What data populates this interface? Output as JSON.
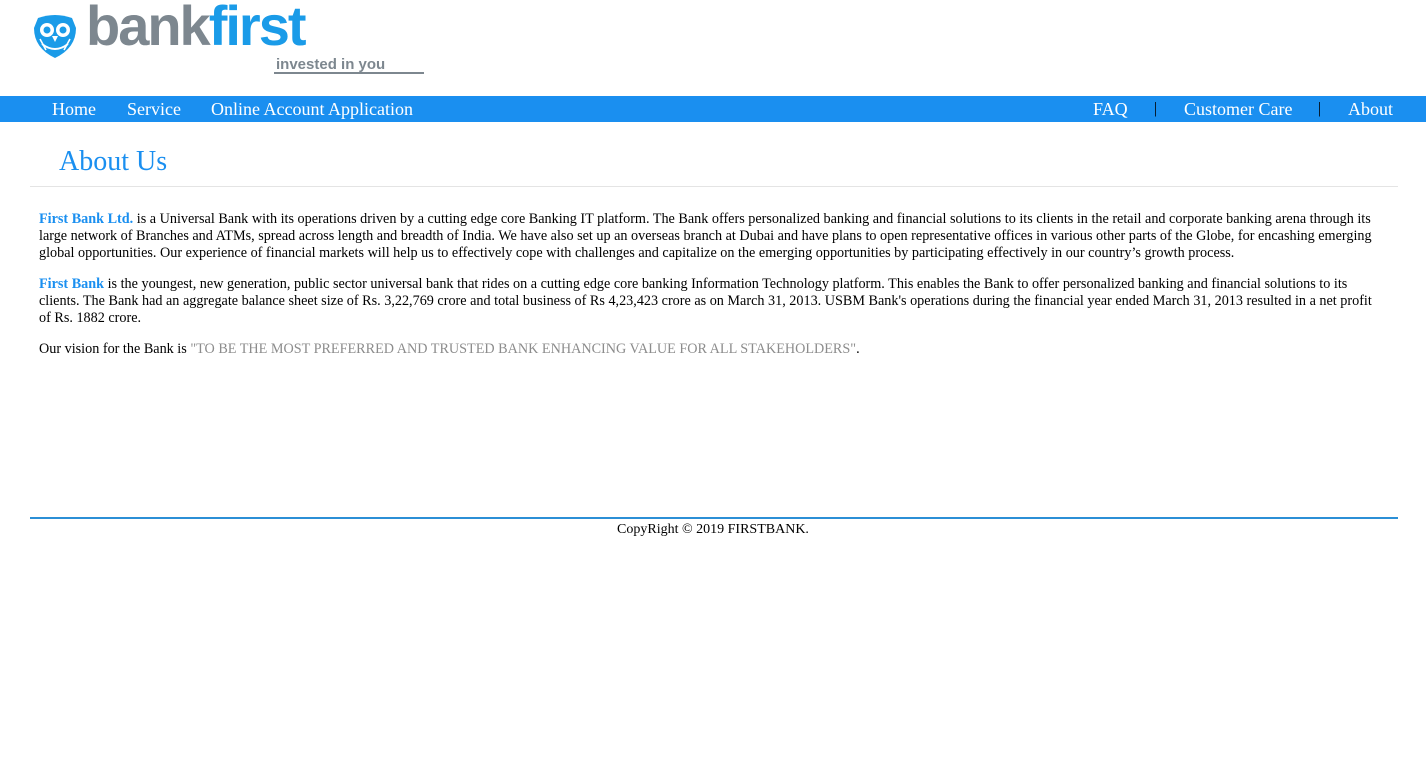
{
  "brand": {
    "name_part1": "bank",
    "name_part2": "first",
    "tagline": "invested in you",
    "colors": {
      "primary": "#1a8ff0",
      "logo_gray": "#7d878f",
      "logo_blue": "#1a9be8"
    }
  },
  "nav": {
    "left": [
      {
        "label": "Home"
      },
      {
        "label": "Service"
      },
      {
        "label": "Online Account Application"
      }
    ],
    "right": [
      {
        "label": "FAQ"
      },
      {
        "label": "Customer Care"
      },
      {
        "label": "About"
      }
    ],
    "separator": "|"
  },
  "page": {
    "title": "About Us",
    "para1": {
      "highlight": "First Bank Ltd.",
      "text": " is a Universal Bank with its operations driven by a cutting edge core Banking IT platform. The Bank offers personalized banking and financial solutions to its clients in the retail and corporate banking arena through its large network of Branches and ATMs, spread across length and breadth of India. We have also set up an overseas branch at Dubai and have plans to open representative offices in various other parts of the Globe, for encashing emerging global opportunities. Our experience of financial markets will help us to effectively cope with challenges and capitalize on the emerging opportunities by participating effectively in our country’s growth process."
    },
    "para2": {
      "highlight": "First Bank",
      "text": " is the youngest, new generation, public sector universal bank that rides on a cutting edge core banking Information Technology platform. This enables the Bank to offer personalized banking and financial solutions to its clients. The Bank had an aggregate balance sheet size of Rs. 3,22,769 crore and total business of Rs 4,23,423 crore as on March 31, 2013. USBM Bank's operations during the financial year ended March 31, 2013 resulted in a net profit of Rs. 1882 crore."
    },
    "para3": {
      "lead": "Our vision for the Bank is ",
      "vision": "\"TO BE THE MOST PREFERRED AND TRUSTED BANK ENHANCING VALUE FOR ALL STAKEHOLDERS\"",
      "end": "."
    }
  },
  "footer": {
    "copyright": "CopyRight © 2019 FIRSTBANK."
  },
  "icons": {
    "logo_icon": "owl-icon"
  }
}
